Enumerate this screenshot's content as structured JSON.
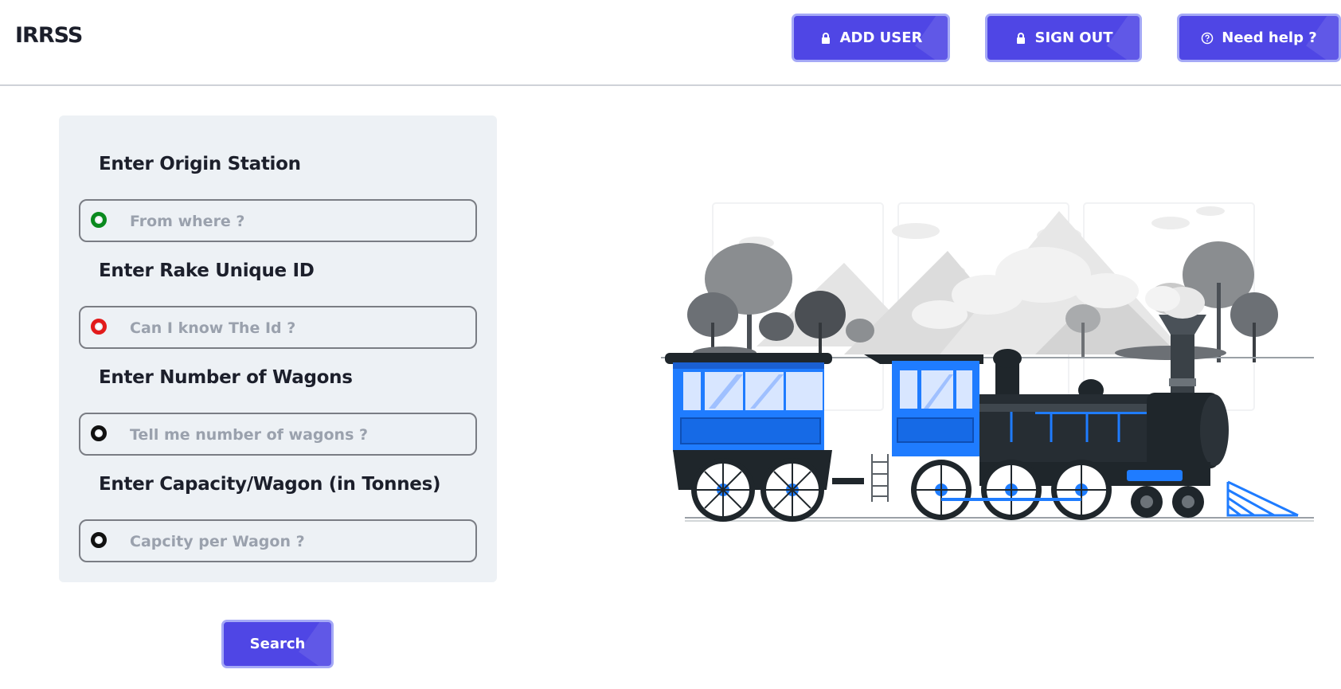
{
  "header": {
    "brand": "IRRSS",
    "buttons": {
      "add_user": "ADD USER",
      "sign_out": "SIGN OUT",
      "help": "Need help ?"
    }
  },
  "form": {
    "origin": {
      "label": "Enter Origin Station",
      "placeholder": "From where ?",
      "value": "",
      "indicator_color": "#0a8a1e"
    },
    "rake_id": {
      "label": "Enter Rake Unique ID",
      "placeholder": "Can I know The Id ?",
      "value": "",
      "indicator_color": "#e21b1b"
    },
    "wagons": {
      "label": "Enter Number of Wagons",
      "placeholder": "Tell me number of wagons ?",
      "value": "",
      "indicator_color": "#111111"
    },
    "capacity": {
      "label": "Enter Capacity/Wagon (in Tonnes)",
      "placeholder": "Capcity per Wagon ?",
      "value": "",
      "indicator_color": "#111111"
    },
    "search_label": "Search"
  },
  "colors": {
    "accent": "#4f46e5",
    "accent_border": "#a5a9f6",
    "train_blue": "#1f7cff",
    "train_dark": "#1f262b"
  },
  "illustration": {
    "subject": "steam-train-illustration"
  }
}
